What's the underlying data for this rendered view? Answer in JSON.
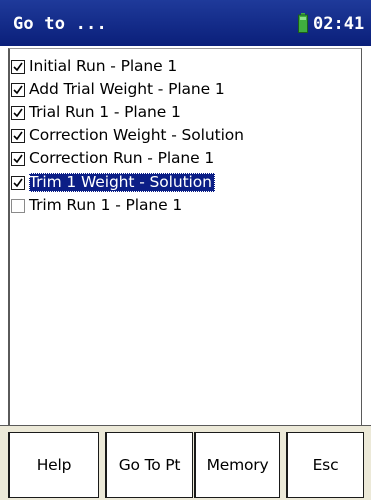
{
  "titlebar": {
    "title": "Go to ...",
    "time": "02:41",
    "battery_icon": "battery-icon"
  },
  "list": {
    "items": [
      {
        "label": "Initial Run - Plane 1",
        "checked": true
      },
      {
        "label": "Add Trial Weight - Plane 1",
        "checked": true
      },
      {
        "label": "Trial Run 1 - Plane 1",
        "checked": true
      },
      {
        "label": "Correction Weight - Solution",
        "checked": true
      },
      {
        "label": "Correction Run - Plane 1",
        "checked": true
      },
      {
        "label": "Trim 1 Weight  - Solution",
        "checked": true,
        "selected": true
      },
      {
        "label": "Trim Run 1 - Plane 1",
        "checked": false
      }
    ]
  },
  "buttons": {
    "help": "Help",
    "go_to_pt": "Go To Pt",
    "memory": "Memory",
    "esc": "Esc"
  },
  "colors": {
    "titlebar": "#0a1f7a",
    "selection": "#0b1e86",
    "battery": "#3fae3f"
  }
}
